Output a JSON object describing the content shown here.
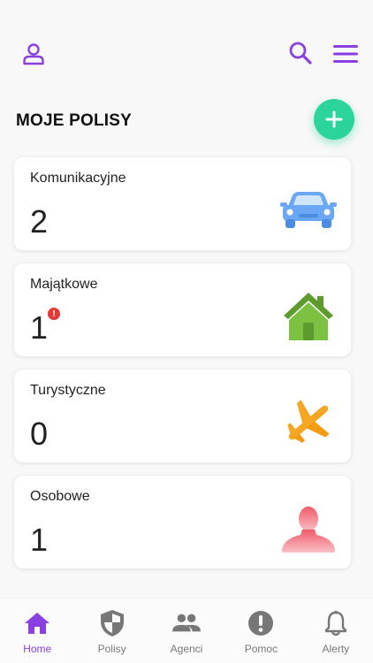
{
  "header": {
    "title": "MOJE POLISY",
    "user_icon": "user-icon",
    "search_icon": "search-icon",
    "menu_icon": "hamburger-menu-icon",
    "add_icon": "plus-icon"
  },
  "colors": {
    "accent": "#8a3fe0",
    "fab": "#2bd49a",
    "alert": "#e53935",
    "tab_inactive": "#777777"
  },
  "cards": [
    {
      "label": "Komunikacyjne",
      "count": "2",
      "icon": "car-icon",
      "alert": false
    },
    {
      "label": "Majątkowe",
      "count": "1",
      "icon": "house-icon",
      "alert": true,
      "alert_mark": "!"
    },
    {
      "label": "Turystyczne",
      "count": "0",
      "icon": "airplane-icon",
      "alert": false
    },
    {
      "label": "Osobowe",
      "count": "1",
      "icon": "person-icon",
      "alert": false
    }
  ],
  "tabs": [
    {
      "label": "Home",
      "icon": "home-icon",
      "active": true
    },
    {
      "label": "Polisy",
      "icon": "shield-icon",
      "active": false
    },
    {
      "label": "Agenci",
      "icon": "people-icon",
      "active": false
    },
    {
      "label": "Pomoc",
      "icon": "help-icon",
      "active": false
    },
    {
      "label": "Alerty",
      "icon": "bell-icon",
      "active": false
    }
  ]
}
